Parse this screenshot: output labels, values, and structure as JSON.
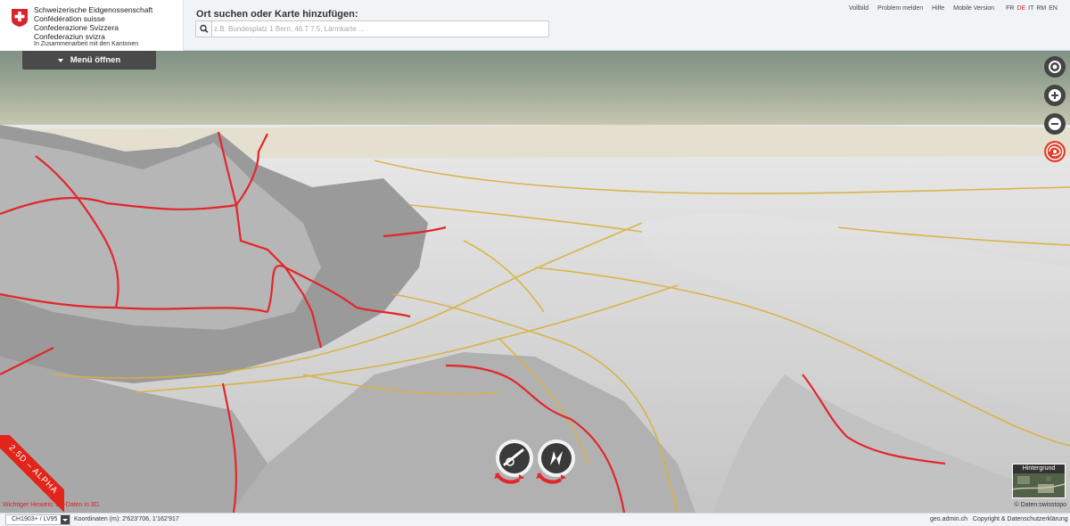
{
  "header": {
    "confederation": {
      "de": "Schweizerische Eidgenossenschaft",
      "fr": "Confédération suisse",
      "it": "Confederazione Svizzera",
      "rm": "Confederaziun svizra"
    },
    "cantons_note": "In Zusammenarbeit mit den Kantonen",
    "search_title": "Ort suchen oder Karte hinzufügen:",
    "search_placeholder": "z.B. Bundesplatz 1 Bern, 46.7 7.5, Lärmkarte ...",
    "links": {
      "fullscreen": "Vollbild",
      "report_problem": "Problem melden",
      "help": "Hilfe",
      "mobile": "Mobile Version"
    },
    "languages": [
      "FR",
      "DE",
      "IT",
      "RM",
      "EN"
    ],
    "active_language": "DE"
  },
  "menu": {
    "open_label": "Menü öffnen"
  },
  "controls": {
    "icons": [
      "geolocate-icon",
      "zoom-in-icon",
      "zoom-out-icon",
      "3d-toggle-icon",
      "rotate-left-icon",
      "compass-icon"
    ]
  },
  "ribbon": {
    "label": "2.5D – ALPHA"
  },
  "notice": "Wichtiger Hinweis: 2D-Daten in 3D.",
  "background_selector": {
    "label": "Hintergrund"
  },
  "attribution": "© Daten:swisstopo",
  "footer": {
    "crs": "CH1903+ / LV95",
    "coords_label": "Koordinaten (m): 2'623'706, 1'162'917",
    "geoadmin": "geo.admin.ch",
    "copyright": "Copyright & Datenschutzerklärung"
  },
  "colors": {
    "brand_red": "#d8232a",
    "trail_red": "#e3262b",
    "road_yellow": "#d8b13a",
    "control_dark": "#444444"
  }
}
